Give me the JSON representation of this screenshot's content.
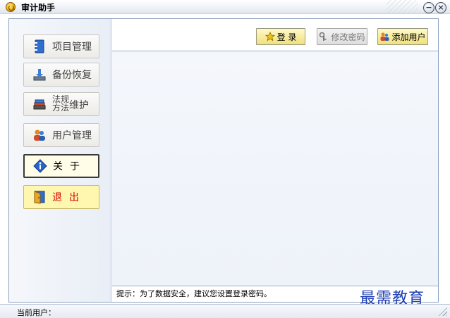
{
  "window": {
    "title": "审计助手",
    "minimize_glyph": "−",
    "close_glyph": "×"
  },
  "nav": {
    "items": [
      {
        "label": "项目管理",
        "icon": "binder-icon"
      },
      {
        "label": "备份恢复",
        "icon": "backup-icon"
      },
      {
        "label_line1": "法规",
        "label_line2": "方法",
        "label_suffix": "维护",
        "icon": "book-stack-icon"
      },
      {
        "label": "用户管理",
        "icon": "users-icon"
      },
      {
        "label": "关于",
        "icon": "info-icon",
        "state": "selected"
      },
      {
        "label": "退出",
        "icon": "exit-door-icon"
      }
    ]
  },
  "toolbar": {
    "login_label": "登 录",
    "change_password_label": "修改密码",
    "add_user_label": "添加用户"
  },
  "hint": "提示：为了数据安全，建议您设置登录密码。",
  "status": {
    "current_user_label": "当前用户："
  },
  "watermark": "最需教育",
  "colors": {
    "toolbar_button": "#f7ec9c",
    "exit_button": "#fff7b0",
    "exit_text": "#d40000",
    "watermark": "#1f3fb5"
  }
}
